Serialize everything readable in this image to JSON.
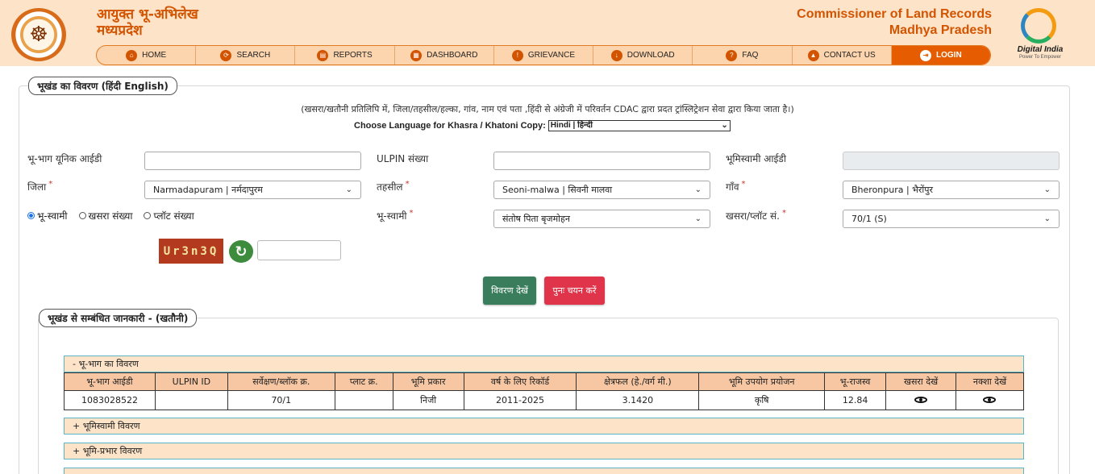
{
  "header": {
    "title_hi_line1": "आयुक्त भू-अभिलेख",
    "title_hi_line2": "मध्यप्रदेश",
    "title_en_line1": "Commissioner of Land Records",
    "title_en_line2": "Madhya Pradesh",
    "digital_india": "Digital India",
    "digital_india_tagline": "Power To Empower",
    "emblem_icon": "mp-emblem",
    "nav": [
      {
        "label": "HOME",
        "icon": "home-icon"
      },
      {
        "label": "SEARCH",
        "icon": "search-icon"
      },
      {
        "label": "REPORTS",
        "icon": "report-icon"
      },
      {
        "label": "DASHBOARD",
        "icon": "dashboard-icon"
      },
      {
        "label": "GRIEVANCE",
        "icon": "grievance-icon"
      },
      {
        "label": "DOWNLOAD",
        "icon": "download-icon"
      },
      {
        "label": "FAQ",
        "icon": "faq-icon"
      },
      {
        "label": "CONTACT US",
        "icon": "contact-icon"
      },
      {
        "label": "LOGIN",
        "icon": "login-icon"
      }
    ]
  },
  "form": {
    "legend": "भूखंड का विवरण  (हिंदी  English)",
    "info_text": "(खसरा/खतौनी प्रतिलिपि में, जिला/तहसील/हल्का, गांव, नाम एवं पता ,हिंदी से अंग्रेजी में परिवर्तन CDAC द्वारा प्रदत ट्रांस्लिट्रेशन सेवा द्वारा किया जाता है।)",
    "lang_label": "Choose Language for Khasra / Khatoni Copy:",
    "lang_value": "Hindi | हिन्दी",
    "unique_id_label": "भू-भाग यूनिक आईडी",
    "unique_id_value": "",
    "ulpin_label": "ULPIN संख्या",
    "ulpin_value": "",
    "owner_id_label": "भूमिस्वामी आईडी",
    "owner_id_value": "",
    "district_label": "जिला",
    "district_value": "Narmadapuram | नर्मदापुरम",
    "tehsil_label": "तहसील",
    "tehsil_value": "Seoni-malwa | सिवनी मालवा",
    "village_label": "गाँव",
    "village_value": "Bheronpura | भैरोंपुर",
    "radio_options": [
      "भू-स्वामी",
      "खसरा संख्या",
      "प्लॉट संख्या"
    ],
    "owner_label": "भू-स्वामी",
    "owner_value": "संतोष पिता बृजमोहन",
    "khasra_label": "खसरा/प्लॉट सं.",
    "khasra_value": "70/1 (S)",
    "required_mark": "*",
    "captcha_text": "Ur3n3Q",
    "captcha_value": "",
    "view_button": "विवरण देखें",
    "reset_button": "पुनः चयन करें"
  },
  "details": {
    "legend": "भूखंड से सम्बंधित जानकारी -   (खतौनी)",
    "panel_land": "- भू-भाग का विवरण",
    "panel_owner": "+ भूमिस्वामी विवरण",
    "panel_charge": "+ भूमि-प्रभार विवरण",
    "columns": [
      "भू-भाग आईडी",
      "ULPIN ID",
      "सर्वेक्षण/ब्लॉक क्र.",
      "प्लाट क्र.",
      "भूमि प्रकार",
      "वर्ष के लिए रिकॉर्ड",
      "क्षेत्रफल (हे./वर्ग मी.)",
      "भूमि उपयोग प्रयोजन",
      "भू-राजस्व",
      "खसरा देखें",
      "नक्शा देखें"
    ],
    "rows": [
      {
        "id": "1083028522",
        "ulpin": "",
        "survey": "70/1",
        "plot": "",
        "land_type": "निजी",
        "year": "2011-2025",
        "area": "3.1420",
        "usage": "कृषि",
        "revenue": "12.84"
      }
    ]
  },
  "colors": {
    "accent_orange": "#d35400",
    "header_bg": "#fde3c8",
    "view_button": "#3a7d5c",
    "reset_button": "#e0344a"
  }
}
